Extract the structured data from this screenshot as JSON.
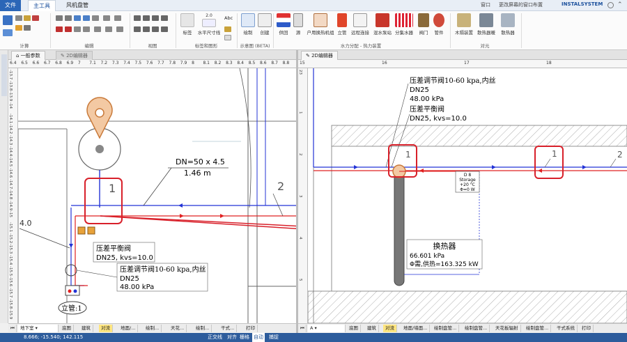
{
  "ribbon": {
    "tabs": [
      "文件",
      "主工具",
      "风机盘管"
    ],
    "right_items": [
      "窗口",
      "更改屏幕的窗口布置",
      "INSTALSYSTEM"
    ],
    "groups": [
      {
        "label": "计算"
      },
      {
        "label": "编辑"
      },
      {
        "label": "视图"
      },
      {
        "label": "标签和图形"
      },
      {
        "label": "示意图 (BETA)"
      },
      {
        "label": "水力分配 - 热力装置"
      },
      {
        "label": "对元"
      }
    ],
    "buttons": {
      "tag": "标签",
      "horiz_dim": "水平尺寸线",
      "abc": "Abc",
      "dim_value": "2.0",
      "draw": "绘制",
      "create": "创建",
      "supply": "供回",
      "source": "源",
      "heater": "户用换热机组",
      "riser": "立管",
      "remote": "远程连接",
      "mix_pump": "混水泵站",
      "manifold": "分集水器",
      "valve": "阀门",
      "pipe": "管件",
      "wood_device": "木隔装置",
      "radiator_heater": "散热器暖",
      "radiator": "散热器"
    }
  },
  "left_view": {
    "doc_tabs": [
      "一般参数",
      "2D编辑器"
    ],
    "ruler_top": [
      "6.4",
      "6.5",
      "6.6",
      "6.7",
      "6.8",
      "6.9",
      "7",
      "7.1",
      "7.2",
      "7.3",
      "7.4",
      "7.5",
      "7.6",
      "7.7",
      "7.8",
      "7.9",
      "8",
      "8.1",
      "8.2",
      "8.3",
      "8.4",
      "8.5",
      "8.6",
      "8.7",
      "8.8"
    ],
    "ruler_left": [
      "-13.7",
      "-13.8",
      "-13.9",
      "-14",
      "-14.1",
      "-14.2",
      "-14.3",
      "-14.4",
      "-14.5",
      "-14.6",
      "-14.7",
      "-14.8",
      "-14.9",
      "-15",
      "-15.1",
      "-15.2",
      "-15.3",
      "-15.4",
      "-15.5",
      "-15.6",
      "-15.7",
      "-15.8",
      "-15.9"
    ],
    "pipe_label": "DN=50 x 4.5",
    "pipe_length": "1.46 m",
    "marker_1": "1",
    "marker_2": "2",
    "left_value": "4.0",
    "balance_valve": "压差平衡阀",
    "balance_spec": "DN25, kvs=10.0",
    "regulator": "压差调节阀10-60 kpa,内丝",
    "regulator_dn": "DN25",
    "regulator_kpa": "48.00 kPa",
    "riser_label": "立管:1",
    "floor_select": "地下室",
    "bottom_tabs": [
      "底图",
      "建筑",
      "对流",
      "地面/...",
      "绘制...",
      "天花...",
      "绘制...",
      "干式...",
      "打印"
    ]
  },
  "right_view": {
    "doc_tabs": [
      "2D编辑器"
    ],
    "ruler_top": [
      "15",
      "16",
      "17",
      "18"
    ],
    "ruler_left": [
      "23",
      "1",
      "2",
      "3",
      "4",
      "5"
    ],
    "regulator": "压差调节阀10-60 kpa,内丝",
    "regulator_dn": "DN25",
    "regulator_kpa": "48.00 kPa",
    "balance_valve": "压差平衡阀",
    "balance_spec": "DN25, kvs=10.0",
    "marker_1a": "1",
    "marker_1b": "1",
    "marker_2": "2",
    "storage_lines": [
      "D 8",
      "Storage",
      "+20 °C",
      "Φ=0 W"
    ],
    "hx_title": "换热器",
    "hx_kpa": "66.601 kPa",
    "hx_power": "Φ需,供热=163.325 kW",
    "floor_select": "A",
    "bottom_tabs": [
      "底图",
      "建筑",
      "对流",
      "地面/墙面...",
      "绘制盘管...",
      "绘制盘管...",
      "天花板辐射",
      "绘制盘管...",
      "干式系统",
      "打印"
    ]
  },
  "status": {
    "coords": "8.666; -15.540; 142.115",
    "modes": [
      "正交线",
      "对齐",
      "栅格",
      "自动",
      "捕捉"
    ]
  },
  "colors": {
    "pipe_red": "#e02020",
    "pipe_blue": "#2333d6",
    "accent": "#2b66b7",
    "highlight": "#d8202a"
  }
}
